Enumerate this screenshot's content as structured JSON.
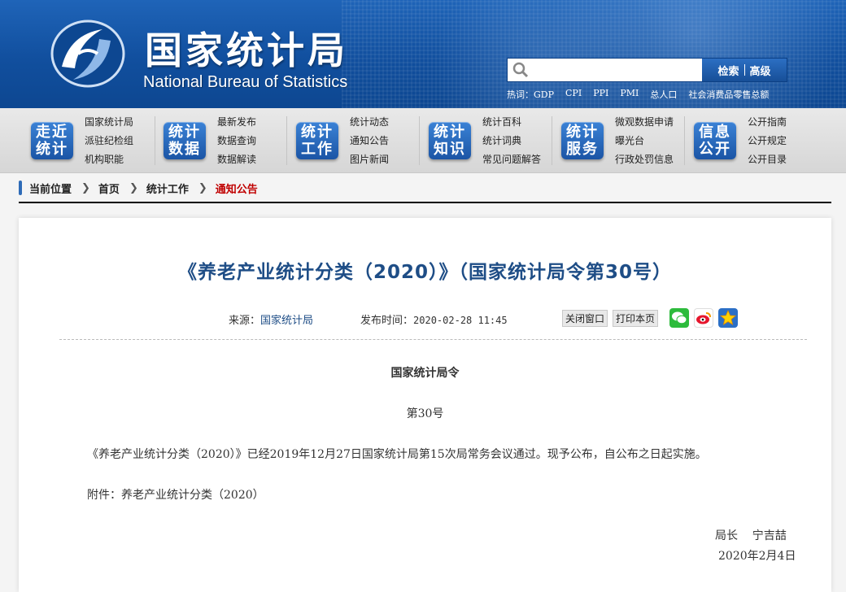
{
  "header": {
    "brand_cn": "国家统计局",
    "brand_en": "National Bureau of Statistics",
    "search": {
      "placeholder": "",
      "search_btn": "检索",
      "advanced_btn": "高级"
    },
    "hotwords": [
      "热词：GDP",
      "CPI",
      "PPI",
      "PMI",
      "总人口",
      "社会消费品零售总额"
    ]
  },
  "nav": [
    {
      "badge": [
        "走近",
        "统计"
      ],
      "links": [
        "国家统计局",
        "派驻纪检组",
        "机构职能"
      ]
    },
    {
      "badge": [
        "统计",
        "数据"
      ],
      "links": [
        "最新发布",
        "数据查询",
        "数据解读"
      ]
    },
    {
      "badge": [
        "统计",
        "工作"
      ],
      "links": [
        "统计动态",
        "通知公告",
        "图片新闻"
      ]
    },
    {
      "badge": [
        "统计",
        "知识"
      ],
      "links": [
        "统计百科",
        "统计词典",
        "常见问题解答"
      ]
    },
    {
      "badge": [
        "统计",
        "服务"
      ],
      "links": [
        "微观数据申请",
        "曝光台",
        "行政处罚信息"
      ]
    },
    {
      "badge": [
        "信息",
        "公开"
      ],
      "links": [
        "公开指南",
        "公开规定",
        "公开目录"
      ]
    }
  ],
  "breadcrumb": {
    "label": "当前位置",
    "items": [
      "首页",
      "统计工作",
      "通知公告"
    ]
  },
  "article": {
    "title": "《养老产业统计分类（2020）》（国家统计局令第30号）",
    "source_label": "来源：",
    "source": "国家统计局",
    "time_label": "发布时间：",
    "time": "2020-02-28  11:45",
    "close_btn": "关闭窗口",
    "print_btn": "打印本页",
    "heading": "国家统计局令",
    "number": "第30号",
    "paragraph": "《养老产业统计分类（2020）》已经2019年12月27日国家统计局第15次局常务会议通过。现予公布，自公布之日起实施。",
    "attachment": "附件：养老产业统计分类（2020）",
    "signer": "局长    宁吉喆",
    "date": "2020年2月4日"
  },
  "colors": {
    "header_blue": "#114f9e",
    "title_blue": "#1e4d86",
    "crumb_red": "#c00000"
  }
}
